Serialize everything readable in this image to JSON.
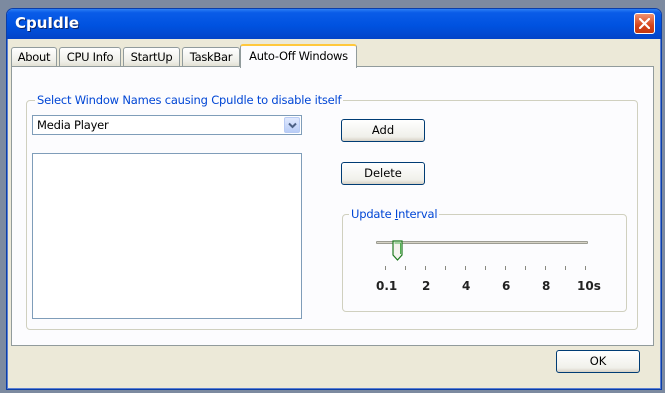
{
  "window": {
    "title": "CpuIdle",
    "close_icon": "close-icon"
  },
  "tabs": [
    {
      "label": "About",
      "active": false
    },
    {
      "label": "CPU Info",
      "active": false
    },
    {
      "label": "StartUp",
      "active": false
    },
    {
      "label": "TaskBar",
      "active": false
    },
    {
      "label": "Auto-Off Windows",
      "active": true
    }
  ],
  "group": {
    "label": "Select Window Names causing CpuIdle to disable itself"
  },
  "window_select": {
    "value": "Media Player",
    "icon": "chevron-down-icon"
  },
  "window_list": {
    "items": []
  },
  "buttons": {
    "add": "Add",
    "delete": "Delete",
    "ok": "OK"
  },
  "update_interval": {
    "label_prefix": "Update ",
    "label_accel": "I",
    "label_suffix": "nterval",
    "value": "0.1",
    "tick_labels": [
      "0.1",
      "2",
      "4",
      "6",
      "8",
      "10s"
    ]
  },
  "colors": {
    "title_bar": "#0052e0",
    "active_tab_accent": "#ffc83c",
    "group_label": "#0046d5"
  }
}
